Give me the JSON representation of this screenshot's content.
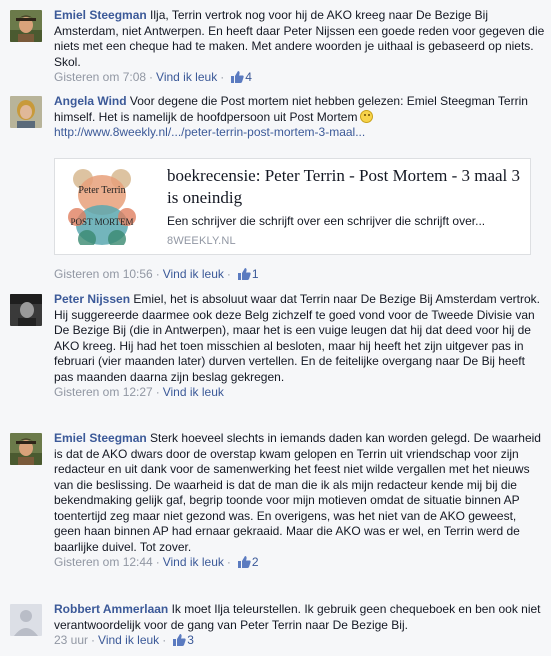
{
  "comments": [
    {
      "name": "Emiel Steegman",
      "text": "Ilja, Terrin vertrok nog voor hij de AKO kreeg naar De Bezige Bij Amsterdam, niet Antwerpen. En heeft daar Peter Nijssen een goede reden voor gegeven die niets met een cheque had te maken. Met andere woorden je uithaal is gebaseerd op niets. Skol.",
      "time": "Gisteren om 7:08",
      "like_label": "Vind ik leuk",
      "likes": "4"
    },
    {
      "name": "Angela Wind",
      "text": "Voor degene die Post mortem niet hebben gelezen: Emiel Steegman Terrin himself. Het is namelijk de hoofdpersoon uit Post Mortem",
      "link": "http://www.8weekly.nl/.../peter-terrin-post-mortem-3-maal...",
      "time": "Gisteren om 10:56",
      "like_label": "Vind ik leuk",
      "likes": "1",
      "preview": {
        "title": "boekrecensie: Peter Terrin - Post Mortem - 3 maal 3 is oneindig",
        "description": "Een schrijver die schrijft over een schrijver die schrijft over...",
        "domain": "8WEEKLY.NL",
        "image_text_top": "Peter Terrin",
        "image_text_bottom": "POST MORTEM"
      }
    },
    {
      "name": "Peter Nijssen",
      "text": "Emiel, het is absoluut waar dat Terrin naar De Bezige Bij Amsterdam vertrok. Hij suggereerde daarmee ook deze Belg zichzelf te goed vond voor de Tweede Divisie van De Bezige Bij (die in Antwerpen), maar het is een vuige leugen dat hij dat deed voor hij de AKO kreeg. Hij had het toen misschien al besloten, maar hij heeft het zijn uitgever pas in februari (vier maanden later) durven vertellen. En de feitelijke overgang naar De Bij heeft pas maanden daarna zijn beslag gekregen.",
      "time": "Gisteren om 12:27",
      "like_label": "Vind ik leuk",
      "likes": ""
    },
    {
      "name": "Emiel Steegman",
      "text": "Sterk hoeveel slechts in iemands daden kan worden gelegd. De waarheid is dat de AKO dwars door de overstap kwam gelopen en Terrin uit vriendschap voor zijn redacteur en uit dank voor de samenwerking het feest niet wilde vergallen met het nieuws van die beslissing. De waarheid is dat de man die ik als mijn redacteur kende mij bij die bekendmaking gelijk gaf, begrip toonde voor mijn motieven omdat de situatie binnen AP toentertijd zeg maar niet gezond was. En overigens, was het niet van de AKO geweest, geen haan binnen AP had ernaar gekraaid. Maar die AKO was er wel, en Terrin werd de baarlijke duivel. Tot zover.",
      "time": "Gisteren om 12:44",
      "like_label": "Vind ik leuk",
      "likes": "2"
    },
    {
      "name": "Robbert Ammerlaan",
      "text": "Ik moet Ilja teleurstellen. Ik gebruik geen chequeboek en ben ook niet verantwoordelijk voor de gang van Peter Terrin naar De Bezige Bij.",
      "time": "23 uur",
      "like_label": "Vind ik leuk",
      "likes": "3"
    }
  ],
  "colors": {
    "link": "#3b5998",
    "meta": "#9197a3",
    "background": "#f6f7f9"
  },
  "icons": {
    "like": "thumbs-up-icon",
    "emoticon": "smiley-icon"
  }
}
